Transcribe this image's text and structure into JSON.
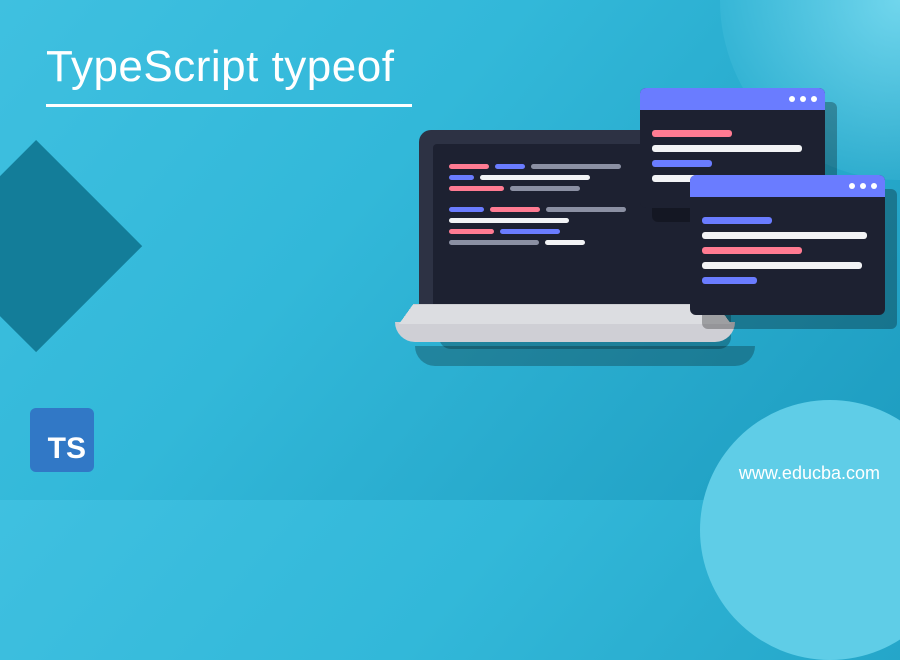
{
  "title": "TypeScript typeof",
  "badge": {
    "label": "TS"
  },
  "site_url": "www.educba.com",
  "palette": {
    "bg_start": "#3fc0e0",
    "bg_end": "#1d9cc0",
    "title_color": "#ffffff",
    "badge_bg": "#3178c6",
    "card_header": "#6a7cff",
    "code_pink": "#ff7b92",
    "code_blue": "#6a7cff",
    "code_white": "#f2f3f5",
    "code_grey": "#8b90a3"
  },
  "icons": {
    "ts_badge": "typescript-logo",
    "laptop": "laptop-icon",
    "code_window": "code-window-icon"
  }
}
